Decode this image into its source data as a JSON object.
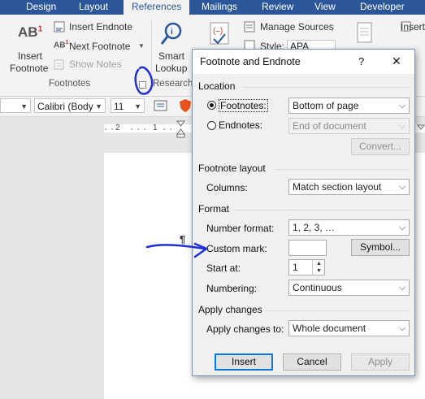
{
  "ribbon": {
    "tabs": [
      {
        "label": "Design"
      },
      {
        "label": "Layout"
      },
      {
        "label": "References"
      },
      {
        "label": "Mailings"
      },
      {
        "label": "Review"
      },
      {
        "label": "View"
      },
      {
        "label": "Developer"
      }
    ],
    "active_tab": "References",
    "footnotes_group": {
      "insert_footnote_line1": "Insert",
      "insert_footnote_line2": "Footnote",
      "insert_endnote": "Insert Endnote",
      "next_footnote": "Next Footnote",
      "show_notes": "Show Notes",
      "group_label": "Footnotes",
      "ab_glyph": "AB",
      "superscript": "1"
    },
    "research_group": {
      "smart_lookup_line1": "Smart",
      "smart_lookup_line2": "Lookup",
      "group_label": "Research"
    },
    "citations_group": {
      "manage_sources": "Manage Sources",
      "style_label": "Style:",
      "style_value": "APA",
      "insert_partial": "Insert"
    },
    "format_bar": {
      "font_name": "Calibri (Body",
      "font_size": "11"
    }
  },
  "ruler": {
    "marks": [
      "2",
      "1"
    ]
  },
  "document": {
    "pilcrow": "¶"
  },
  "dialog": {
    "title": "Footnote and Endnote",
    "help": "?",
    "close": "✕",
    "location": {
      "heading": "Location",
      "footnotes_label": "Footnotes:",
      "footnotes_value": "Bottom of page",
      "endnotes_label": "Endnotes:",
      "endnotes_value": "End of document",
      "convert_button": "Convert...",
      "selected": "footnotes"
    },
    "footnote_layout": {
      "heading": "Footnote layout",
      "columns_label": "Columns:",
      "columns_value": "Match section layout"
    },
    "format": {
      "heading": "Format",
      "number_format_label": "Number format:",
      "number_format_value": "1, 2, 3, …",
      "custom_mark_label": "Custom mark:",
      "custom_mark_value": "",
      "symbol_button": "Symbol...",
      "start_at_label": "Start at:",
      "start_at_value": "1",
      "numbering_label": "Numbering:",
      "numbering_value": "Continuous"
    },
    "apply_changes": {
      "heading": "Apply changes",
      "apply_to_label": "Apply changes to:",
      "apply_to_value": "Whole document"
    },
    "buttons": {
      "insert": "Insert",
      "cancel": "Cancel",
      "apply": "Apply"
    }
  },
  "colors": {
    "ribbon_blue": "#2b579a",
    "annotation_blue": "#1f2fd6",
    "default_button_border": "#0078d7"
  }
}
